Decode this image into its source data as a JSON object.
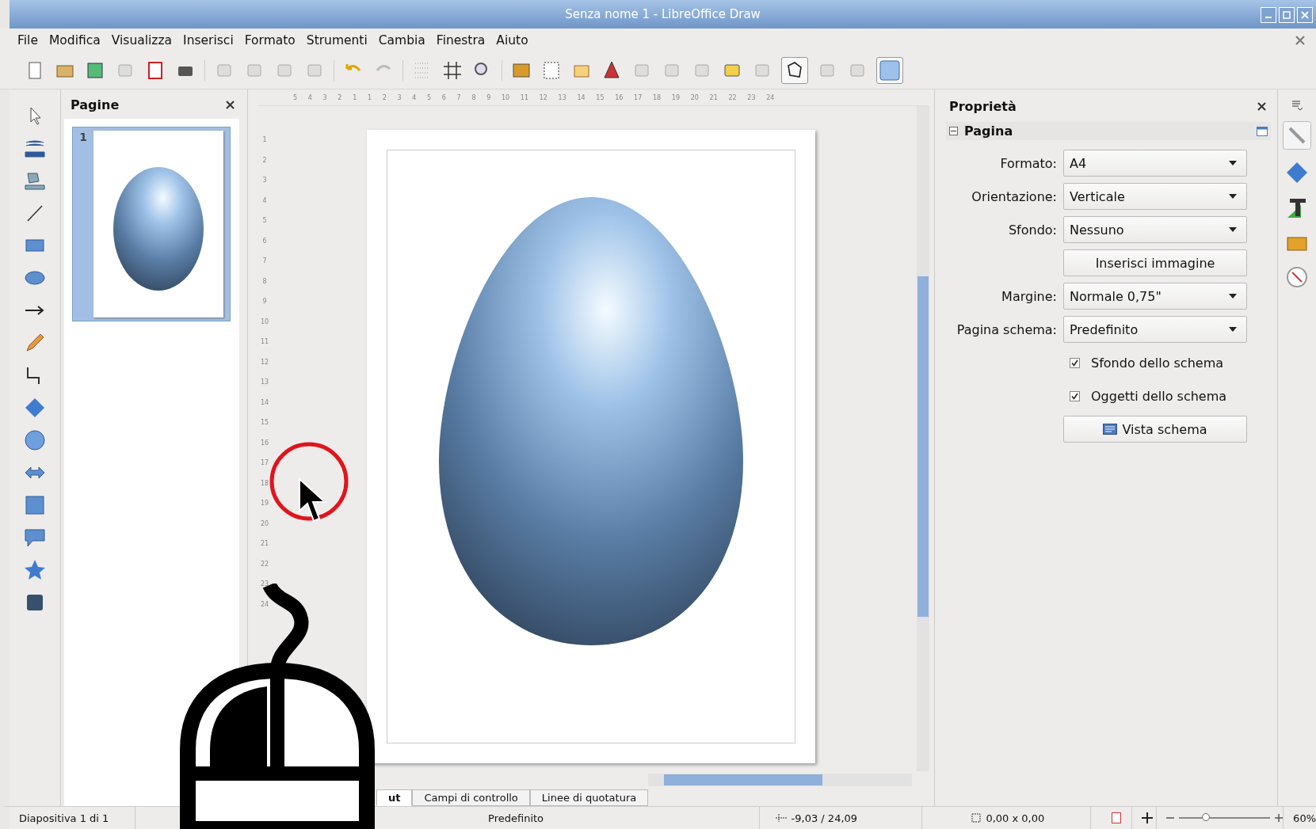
{
  "window": {
    "title": "Senza nome 1 - LibreOffice Draw"
  },
  "menu": [
    "File",
    "Modifica",
    "Visualizza",
    "Inserisci",
    "Formato",
    "Strumenti",
    "Cambia",
    "Finestra",
    "Aiuto"
  ],
  "pages_panel": {
    "title": "Pagine",
    "slides": [
      {
        "number": "1",
        "selected": true
      }
    ]
  },
  "rulers": {
    "horizontal": [
      "5",
      "4",
      "3",
      "2",
      "1",
      "1",
      "2",
      "3",
      "4",
      "5",
      "6",
      "7",
      "8",
      "9",
      "10",
      "11",
      "12",
      "13",
      "14",
      "15",
      "16",
      "17",
      "18",
      "19",
      "20",
      "21",
      "22",
      "23",
      "24"
    ],
    "vertical": [
      "1",
      "2",
      "3",
      "4",
      "5",
      "6",
      "7",
      "8",
      "9",
      "10",
      "11",
      "12",
      "13",
      "14",
      "15",
      "16",
      "17",
      "18",
      "19",
      "20",
      "21",
      "22",
      "23",
      "24"
    ]
  },
  "layer_tabs": [
    {
      "label": "ut",
      "selected": true
    },
    {
      "label": "Campi di controllo",
      "selected": false
    },
    {
      "label": "Linee di quotatura",
      "selected": false
    }
  ],
  "sidebar": {
    "title": "Proprietà",
    "section": {
      "title": "Pagina",
      "expanded": true,
      "rows": [
        {
          "kind": "dropdown",
          "label": "Formato:",
          "value": "A4"
        },
        {
          "kind": "dropdown",
          "label": "Orientazione:",
          "value": "Verticale"
        },
        {
          "kind": "dropdown",
          "label": "Sfondo:",
          "value": "Nessuno"
        },
        {
          "kind": "button",
          "value": "Inserisci immagine"
        },
        {
          "kind": "dropdown",
          "label": "Margine:",
          "value": "Normale 0,75\""
        },
        {
          "kind": "dropdown",
          "label": "Pagina schema:",
          "value": "Predefinito"
        },
        {
          "kind": "checkbox",
          "value": "Sfondo dello schema",
          "checked": true
        },
        {
          "kind": "checkbox",
          "value": "Oggetti dello schema",
          "checked": true
        },
        {
          "kind": "iconbutton",
          "value": "Vista schema"
        }
      ]
    }
  },
  "status_bar": {
    "slide": "Diapositiva 1 di 1",
    "master": "Predefinito",
    "position": "-9,03 / 24,09",
    "size": "0,00 x 0,00",
    "zoom": {
      "level": 0.3,
      "label": "60%"
    }
  }
}
